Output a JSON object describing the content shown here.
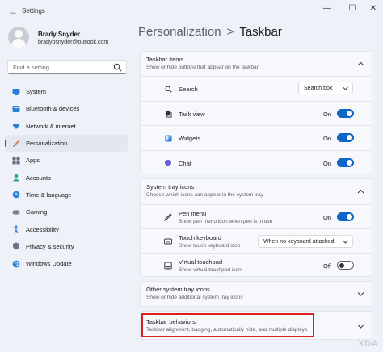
{
  "window": {
    "title": "Settings",
    "back_glyph": "←",
    "min_glyph": "—",
    "max_glyph": "☐",
    "close_glyph": "✕"
  },
  "user": {
    "name": "Brady Snyder",
    "email": "bradypsnyder@outlook.com"
  },
  "search": {
    "placeholder": "Find a setting"
  },
  "nav": [
    {
      "label": "System",
      "icon": "monitor-icon",
      "active": false
    },
    {
      "label": "Bluetooth & devices",
      "icon": "bluetooth-icon",
      "active": false
    },
    {
      "label": "Network & internet",
      "icon": "wifi-icon",
      "active": false
    },
    {
      "label": "Personalization",
      "icon": "brush-icon",
      "active": true
    },
    {
      "label": "Apps",
      "icon": "apps-icon",
      "active": false
    },
    {
      "label": "Accounts",
      "icon": "person-icon",
      "active": false
    },
    {
      "label": "Time & language",
      "icon": "globe-clock-icon",
      "active": false
    },
    {
      "label": "Gaming",
      "icon": "gamepad-icon",
      "active": false
    },
    {
      "label": "Accessibility",
      "icon": "accessibility-icon",
      "active": false
    },
    {
      "label": "Privacy & security",
      "icon": "shield-icon",
      "active": false
    },
    {
      "label": "Windows Update",
      "icon": "update-icon",
      "active": false
    }
  ],
  "breadcrumb": {
    "parent": "Personalization",
    "separator": ">",
    "current": "Taskbar"
  },
  "taskbar_items": {
    "title": "Taskbar items",
    "subtitle": "Show or hide buttons that appear on the taskbar",
    "rows": [
      {
        "label": "Search",
        "icon": "search-icon",
        "control": "dropdown",
        "value": "Search box"
      },
      {
        "label": "Task view",
        "icon": "task-view-icon",
        "control": "toggle",
        "state": "On",
        "on": true
      },
      {
        "label": "Widgets",
        "icon": "widgets-icon",
        "control": "toggle",
        "state": "On",
        "on": true
      },
      {
        "label": "Chat",
        "icon": "chat-icon",
        "control": "toggle",
        "state": "On",
        "on": true
      }
    ]
  },
  "system_tray_icons": {
    "title": "System tray icons",
    "subtitle": "Choose which icons can appear in the system tray",
    "rows": [
      {
        "label": "Pen menu",
        "sub": "Show pen menu icon when pen is in use",
        "icon": "pen-icon",
        "control": "toggle",
        "state": "On",
        "on": true
      },
      {
        "label": "Touch keyboard",
        "sub": "Show touch keyboard icon",
        "icon": "keyboard-icon",
        "control": "dropdown",
        "value": "When no keyboard attached"
      },
      {
        "label": "Virtual touchpad",
        "sub": "Show virtual touchpad icon",
        "icon": "touchpad-icon",
        "control": "toggle",
        "state": "Off",
        "on": false
      }
    ]
  },
  "other_tray_icons": {
    "title": "Other system tray icons",
    "subtitle": "Show or hide additional system tray icons"
  },
  "taskbar_behaviors": {
    "title": "Taskbar behaviors",
    "subtitle": "Taskbar alignment, badging, automatically hide, and multiple displays"
  },
  "colors": {
    "accent": "#0f64c8",
    "highlight": "#d92121"
  },
  "watermark": "XDA"
}
